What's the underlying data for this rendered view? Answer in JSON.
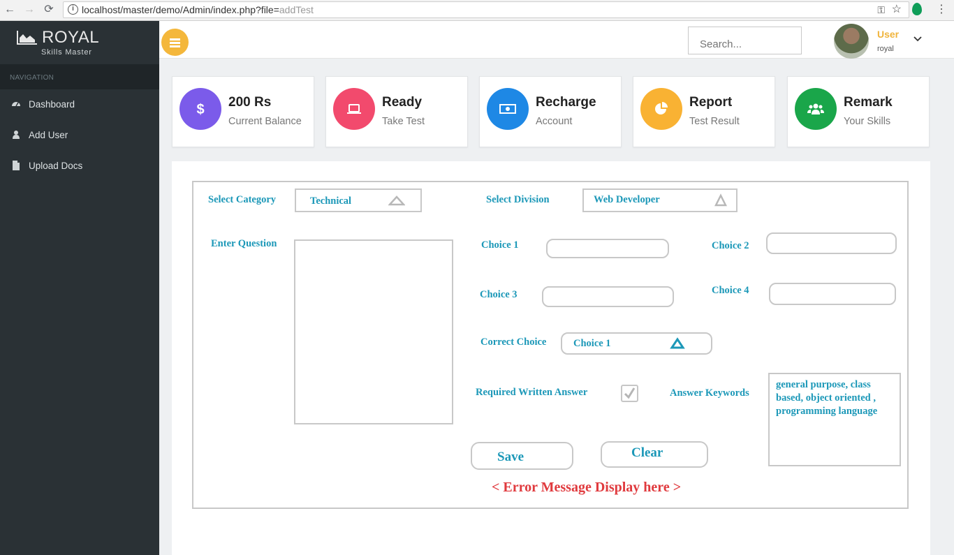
{
  "browser": {
    "url_base": "localhost/master/demo/Admin/index.php?file=",
    "url_query": "addTest"
  },
  "brand": {
    "title": "ROYAL",
    "subtitle": "Skills Master"
  },
  "sidebar": {
    "heading": "NAVIGATION",
    "items": [
      {
        "label": "Dashboard",
        "icon": "dashboard-icon"
      },
      {
        "label": "Add User",
        "icon": "user-icon"
      },
      {
        "label": "Upload Docs",
        "icon": "file-icon"
      }
    ]
  },
  "header": {
    "search_placeholder": "Search...",
    "user_name": "User",
    "user_sub": "royal"
  },
  "cards": [
    {
      "title": "200 Rs",
      "subtitle": "Current Balance",
      "color": "#7b5bea",
      "icon": "dollar-icon"
    },
    {
      "title": "Ready",
      "subtitle": "Take Test",
      "color": "#f24a6d",
      "icon": "laptop-icon"
    },
    {
      "title": "Recharge",
      "subtitle": "Account",
      "color": "#1e88e5",
      "icon": "money-icon"
    },
    {
      "title": "Report",
      "subtitle": "Test Result",
      "color": "#f9b233",
      "icon": "pie-chart-icon"
    },
    {
      "title": "Remark",
      "subtitle": "Your Skills",
      "color": "#1aa64a",
      "icon": "users-icon"
    }
  ],
  "form": {
    "category_label": "Select Category",
    "category_value": "Technical",
    "division_label": "Select Division",
    "division_value": "Web Developer",
    "question_label": "Enter Question",
    "choice1_label": "Choice 1",
    "choice2_label": "Choice 2",
    "choice3_label": "Choice 3",
    "choice4_label": "Choice 4",
    "correct_label": "Correct Choice",
    "correct_value": "Choice 1",
    "required_label": "Required Written Answer",
    "required_checked": true,
    "keywords_label": "Answer Keywords",
    "keywords_value": "general purpose, class based, object oriented , programming language",
    "save_label": "Save",
    "clear_label": "Clear",
    "error_message": "< Error Message Display here >"
  },
  "colors": {
    "sidebar_bg": "#2a3135",
    "accent": "#f4b73b",
    "form_text": "#1c98b8",
    "error_text": "#e03a3e"
  }
}
